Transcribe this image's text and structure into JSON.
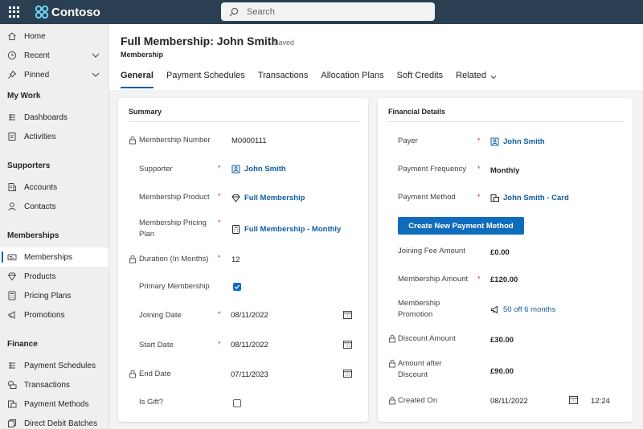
{
  "app": {
    "name": "Contoso",
    "search_placeholder": "Search"
  },
  "sidebar": {
    "top": [
      {
        "label": "Home",
        "icon": "home-icon"
      },
      {
        "label": "Recent",
        "icon": "clock-icon"
      },
      {
        "label": "Pinned",
        "icon": "pin-icon"
      }
    ],
    "sections": [
      {
        "title": "My Work",
        "items": [
          "Dashboards",
          "Activities"
        ]
      },
      {
        "title": "Supporters",
        "items": [
          "Accounts",
          "Contacts"
        ]
      },
      {
        "title": "Memberships",
        "items": [
          "Memberships",
          "Products",
          "Pricing Plans",
          "Promotions"
        ]
      },
      {
        "title": "Finance",
        "items": [
          "Payment Schedules",
          "Transactions",
          "Payment Methods",
          "Direct Debit Batches"
        ]
      }
    ],
    "active_item": "Memberships"
  },
  "header": {
    "title": "Full Membership: John Smith",
    "status": "- Saved",
    "entity": "Membership"
  },
  "tabs": [
    "General",
    "Payment Schedules",
    "Transactions",
    "Allocation Plans",
    "Soft Credits",
    "Related"
  ],
  "active_tab": "General",
  "summary": {
    "title": "Summary",
    "membership_number": {
      "label": "Membership Number",
      "value": "M0000111"
    },
    "supporter": {
      "label": "Supporter",
      "value": "John Smith"
    },
    "membership_product": {
      "label": "Membership Product",
      "value": "Full Membership"
    },
    "pricing_plan": {
      "label_line1": "Membership Pricing",
      "label_line2": "Plan",
      "value": "Full Membership - Monthly"
    },
    "duration": {
      "label": "Duration (In Months)",
      "value": "12"
    },
    "primary_membership": {
      "label": "Primary Membership",
      "checked": true
    },
    "joining_date": {
      "label": "Joining Date",
      "value": "08/11/2022"
    },
    "start_date": {
      "label": "Start Date",
      "value": "08/11/2022"
    },
    "end_date": {
      "label": "End Date",
      "value": "07/11/2023"
    },
    "is_gift": {
      "label": "Is Gift?",
      "checked": false
    }
  },
  "financial": {
    "title": "Financial Details",
    "payer": {
      "label": "Payer",
      "value": "John Smith"
    },
    "payment_frequency": {
      "label": "Payment Frequency",
      "value": "Monthly"
    },
    "payment_method": {
      "label": "Payment Method",
      "value": "John Smith - Card"
    },
    "create_button": "Create New Payment Method",
    "joining_fee": {
      "label": "Joining Fee Amount",
      "value": "£0.00"
    },
    "membership_amount": {
      "label": "Membership Amount",
      "value": "£120.00"
    },
    "promotion": {
      "label_line1": "Membership",
      "label_line2": "Promotion",
      "value": "50 off 6 months"
    },
    "discount_amount": {
      "label": "Discount Amount",
      "value": "£30.00"
    },
    "amount_after_discount": {
      "label_line1": "Amount after",
      "label_line2": "Discount",
      "value": "£90.00"
    },
    "created_on": {
      "label": "Created On",
      "date": "08/11/2022",
      "time": "12:24"
    }
  },
  "colors": {
    "topbar": "#2a3f52",
    "accent": "#0f6cbd",
    "link": "#115ea3",
    "required": "#c4314b"
  }
}
